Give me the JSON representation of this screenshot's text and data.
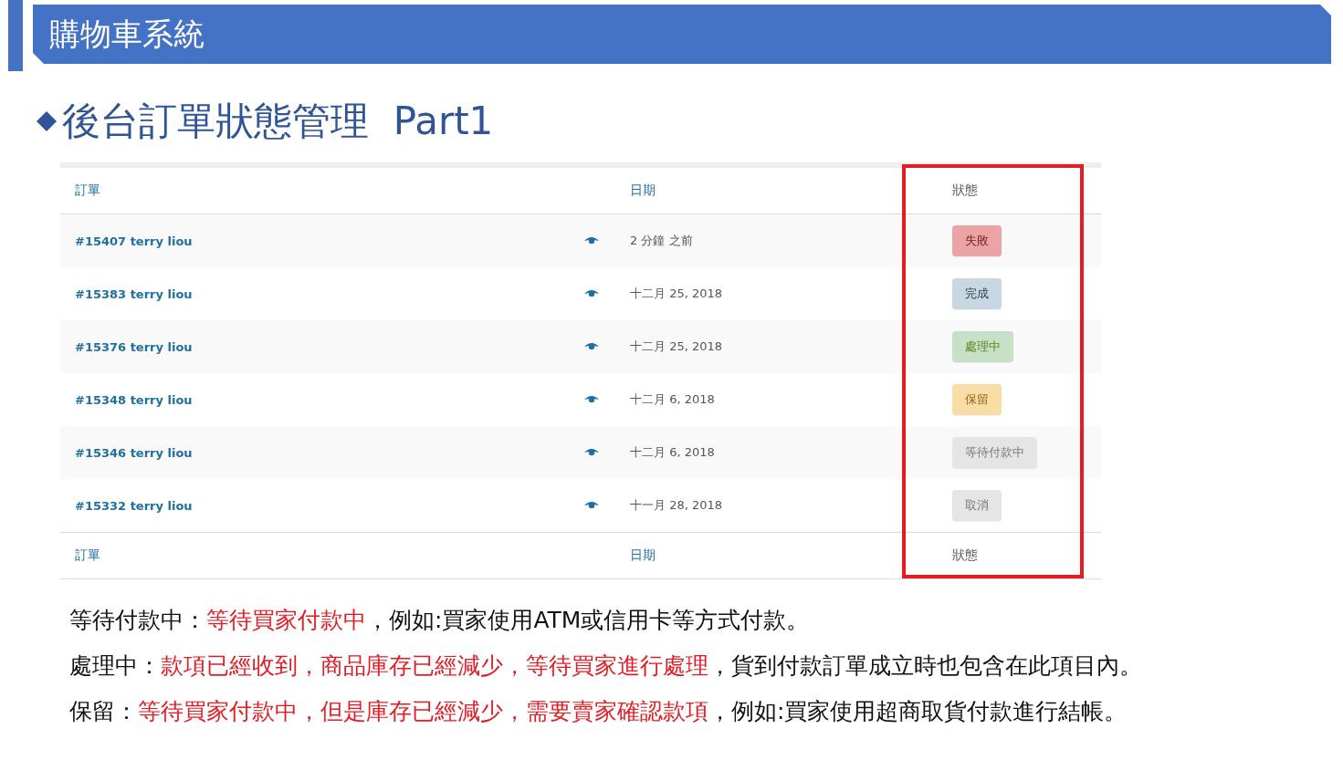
{
  "header": {
    "title": "購物車系統"
  },
  "heading": {
    "text": "後台訂單狀態管理  Part1"
  },
  "table": {
    "columns": [
      {
        "label": "訂單",
        "kind": "link"
      },
      {
        "label": "日期",
        "kind": "link"
      },
      {
        "label": "狀態",
        "kind": "plain"
      }
    ],
    "rows": [
      {
        "order": "#15407 terry liou",
        "date": "2 分鐘 之前",
        "status": {
          "label": "失敗",
          "kind": "failed"
        }
      },
      {
        "order": "#15383 terry liou",
        "date": "十二月 25, 2018",
        "status": {
          "label": "完成",
          "kind": "completed"
        }
      },
      {
        "order": "#15376 terry liou",
        "date": "十二月 25, 2018",
        "status": {
          "label": "處理中",
          "kind": "processing"
        }
      },
      {
        "order": "#15348 terry liou",
        "date": "十二月 6, 2018",
        "status": {
          "label": "保留",
          "kind": "on-hold"
        }
      },
      {
        "order": "#15346 terry liou",
        "date": "十二月 6, 2018",
        "status": {
          "label": "等待付款中",
          "kind": "pending"
        }
      },
      {
        "order": "#15332 terry liou",
        "date": "十一月 28, 2018",
        "status": {
          "label": "取消",
          "kind": "cancelled"
        }
      }
    ],
    "footer": [
      {
        "label": "訂單",
        "kind": "link"
      },
      {
        "label": "日期",
        "kind": "link"
      },
      {
        "label": "狀態",
        "kind": "plain"
      }
    ]
  },
  "notes": [
    {
      "segments": [
        {
          "text": "等待付款中：",
          "highlight": false
        },
        {
          "text": "等待買家付款中",
          "highlight": true
        },
        {
          "text": "，例如:買家使用ATM或信用卡等方式付款。",
          "highlight": false
        }
      ]
    },
    {
      "segments": [
        {
          "text": "處理中：",
          "highlight": false
        },
        {
          "text": "款項已經收到，商品庫存已經減少，等待買家進行處理",
          "highlight": true
        },
        {
          "text": "，貨到付款訂單成立時也包含在此項目內。",
          "highlight": false
        }
      ]
    },
    {
      "segments": [
        {
          "text": "保留：",
          "highlight": false
        },
        {
          "text": "等待買家付款中，但是庫存已經減少，需要賣家確認款項",
          "highlight": true
        },
        {
          "text": "，例如:買家使用超商取貨付款進行結帳。",
          "highlight": false
        }
      ]
    }
  ]
}
